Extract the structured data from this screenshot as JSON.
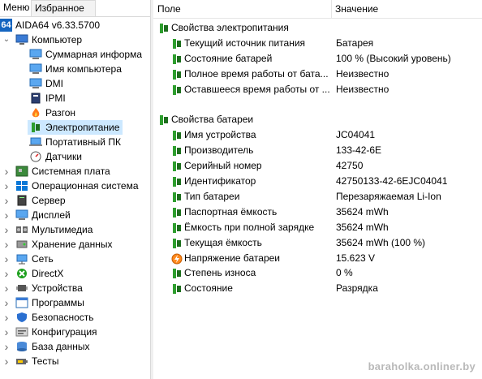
{
  "tabs": {
    "menu": "Меню",
    "favorites": "Избранное"
  },
  "tree": {
    "root": {
      "badge": "64",
      "label": "AIDA64 v6.33.5700"
    },
    "computer": "Компьютер",
    "computer_children": [
      "Суммарная информа",
      "Имя компьютера",
      "DMI",
      "IPMI",
      "Разгон",
      "Электропитание",
      "Портативный ПК",
      "Датчики"
    ],
    "groups": [
      "Системная плата",
      "Операционная система",
      "Сервер",
      "Дисплей",
      "Мультимедиа",
      "Хранение данных",
      "Сеть",
      "DirectX",
      "Устройства",
      "Программы",
      "Безопасность",
      "Конфигурация",
      "База данных",
      "Тесты"
    ]
  },
  "header": {
    "field": "Поле",
    "value": "Значение"
  },
  "sections": [
    {
      "title": "Свойства электропитания",
      "rows": [
        {
          "field": "Текущий источник питания",
          "value": "Батарея",
          "icon": "plug-icon"
        },
        {
          "field": "Состояние батарей",
          "value": "100 % (Высокий уровень)",
          "icon": "plug-icon"
        },
        {
          "field": "Полное время работы от бата...",
          "value": "Неизвестно",
          "icon": "plug-icon"
        },
        {
          "field": "Оставшееся время работы от ...",
          "value": "Неизвестно",
          "icon": "plug-icon"
        }
      ]
    },
    {
      "title": "Свойства батареи",
      "rows": [
        {
          "field": "Имя устройства",
          "value": "JC04041",
          "icon": "plug-icon"
        },
        {
          "field": "Производитель",
          "value": "133-42-6E",
          "icon": "plug-icon"
        },
        {
          "field": "Серийный номер",
          "value": "42750",
          "icon": "plug-icon"
        },
        {
          "field": "Идентификатор",
          "value": "42750133-42-6EJC04041",
          "icon": "plug-icon"
        },
        {
          "field": "Тип батареи",
          "value": "Перезаряжаемая Li-Ion",
          "icon": "plug-icon"
        },
        {
          "field": "Паспортная ёмкость",
          "value": "35624 mWh",
          "icon": "plug-icon"
        },
        {
          "field": "Ёмкость при полной зарядке",
          "value": "35624 mWh",
          "icon": "plug-icon"
        },
        {
          "field": "Текущая ёмкость",
          "value": "35624 mWh  (100 %)",
          "icon": "plug-icon"
        },
        {
          "field": "Напряжение батареи",
          "value": "15.623 V",
          "icon": "voltage-icon"
        },
        {
          "field": "Степень износа",
          "value": "0 %",
          "icon": "plug-icon"
        },
        {
          "field": "Состояние",
          "value": "Разрядка",
          "icon": "plug-icon"
        }
      ]
    }
  ],
  "watermark": "baraholka.onliner.by"
}
